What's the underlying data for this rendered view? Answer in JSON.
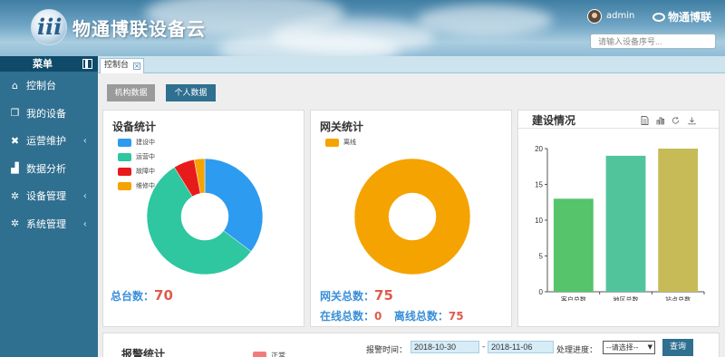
{
  "header": {
    "logo_glyph": "iii",
    "app_title": "物通博联设备云",
    "username": "admin",
    "brand": "物通博联",
    "search_placeholder": "请输入设备序号..."
  },
  "sidebar": {
    "menu_label": "菜单",
    "items": [
      {
        "label": "控制台",
        "icon": "home-icon",
        "has_submenu": false
      },
      {
        "label": "我的设备",
        "icon": "copy-icon",
        "has_submenu": false
      },
      {
        "label": "运营维护",
        "icon": "tools-icon",
        "has_submenu": true
      },
      {
        "label": "数据分析",
        "icon": "chart-icon",
        "has_submenu": false
      },
      {
        "label": "设备管理",
        "icon": "gear-icon",
        "has_submenu": true
      },
      {
        "label": "系统管理",
        "icon": "gear-icon",
        "has_submenu": true
      }
    ]
  },
  "tabs": [
    {
      "label": "控制台"
    }
  ],
  "toolbar": {
    "org_data": "机构数据",
    "personal_data": "个人数据"
  },
  "device_stats": {
    "title": "设备统计",
    "legend": [
      {
        "label": "建设中",
        "color": "#2c9bf0"
      },
      {
        "label": "运营中",
        "color": "#2ec7a0"
      },
      {
        "label": "故障中",
        "color": "#e81b1b"
      },
      {
        "label": "维修中",
        "color": "#f5a300"
      }
    ],
    "total_label": "总台数：",
    "total_value": "70"
  },
  "gateway_stats": {
    "title": "网关统计",
    "legend": [
      {
        "label": "离线",
        "color": "#f5a300"
      }
    ],
    "total_label": "网关总数：",
    "total_value": "75",
    "online_label": "在线总数：",
    "online_value": "0",
    "offline_label": "离线总数：",
    "offline_value": "75"
  },
  "construction": {
    "title": "建设情况",
    "tool_icons": [
      "document-icon",
      "bar-chart-icon",
      "refresh-icon",
      "download-icon"
    ]
  },
  "chart_data": [
    {
      "type": "pie",
      "title": "设备统计",
      "categories": [
        "建设中",
        "运营中",
        "故障中",
        "维修中"
      ],
      "values": [
        24,
        38,
        4,
        2
      ],
      "colors": [
        "#2c9bf0",
        "#2ec7a0",
        "#e81b1b",
        "#f5a300"
      ]
    },
    {
      "type": "pie",
      "title": "网关统计",
      "categories": [
        "离线"
      ],
      "values": [
        75
      ],
      "colors": [
        "#f5a300"
      ]
    },
    {
      "type": "bar",
      "title": "建设情况",
      "categories": [
        "客户总数",
        "地区总数",
        "站点总数"
      ],
      "values": [
        13,
        19,
        20
      ],
      "colors": [
        "#55c46a",
        "#52c49c",
        "#c6bb56"
      ],
      "ylim": [
        0,
        20
      ],
      "yticks": [
        "0",
        "5",
        "10",
        "15",
        "20"
      ],
      "grid": false
    }
  ],
  "alarm": {
    "title": "报警统计",
    "legend_label": "正常",
    "legend_color": "#f27c7c",
    "time_label": "报警时间：",
    "date_from": "2018-10-30",
    "date_sep": "-",
    "date_to": "2018-11-06",
    "progress_label": "处理进度：",
    "progress_select": "--请选择--",
    "query_button": "查询"
  }
}
